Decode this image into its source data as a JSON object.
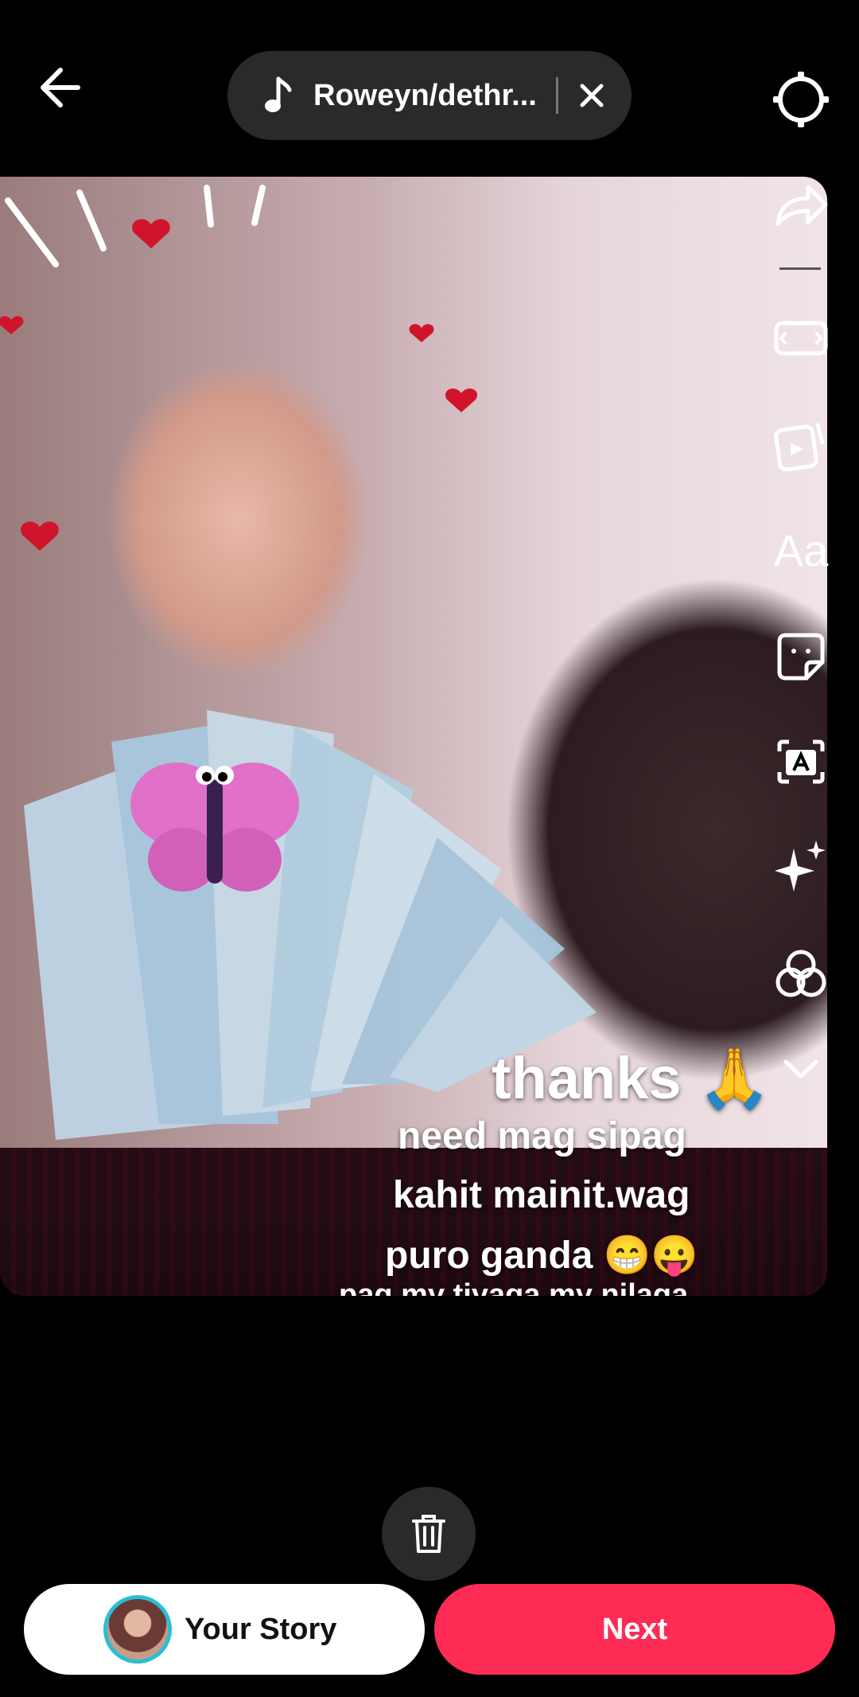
{
  "top_bar": {
    "music_title": "Roweyn/dethr...",
    "icons": {
      "back": "arrow-left-icon",
      "music": "music-note-icon",
      "close": "close-icon",
      "settings": "gear-icon"
    }
  },
  "captions": {
    "thanks": "thanks 🙏",
    "line1": "need mag sipag",
    "line2": "kahit mainit.wag",
    "line3": "puro ganda 😁😛",
    "line4": "pag my tiyaga my nilaga"
  },
  "toolbar": {
    "text_tool_label": "Aa",
    "icons": [
      "share-arrow-icon",
      "crop-icon",
      "templates-icon",
      "text-icon",
      "sticker-icon",
      "caption-icon",
      "effects-sparkle-icon",
      "filters-icon",
      "chevron-down-icon"
    ]
  },
  "bottom": {
    "your_story_label": "Your Story",
    "next_label": "Next",
    "delete_icon": "trash-icon",
    "next_color": "#fe2c55",
    "avatar_ring_color": "#28bfd6"
  }
}
